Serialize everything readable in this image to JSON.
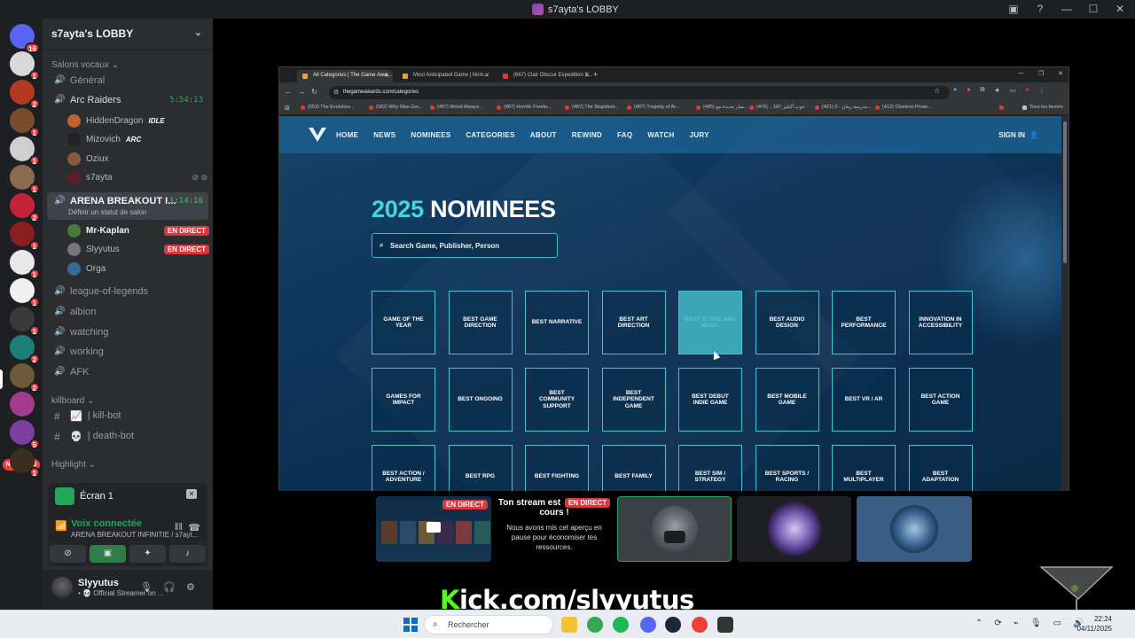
{
  "window": {
    "title": "s7ayta's LOBBY",
    "controls": [
      "mail-icon",
      "help-icon",
      "minimize-icon",
      "maximize-icon",
      "close-icon"
    ]
  },
  "rail": {
    "servers": [
      {
        "name": "discord-home",
        "badge": "16",
        "color": "#5865f2"
      },
      {
        "name": "server-1",
        "badge": "1",
        "color": "#d9d9d9"
      },
      {
        "name": "server-2",
        "badge": "2",
        "color": "#b23a1e"
      },
      {
        "name": "server-3",
        "badge": "1",
        "color": "#7a4b2a"
      },
      {
        "name": "server-4",
        "badge": "1",
        "color": "#cfcfcf"
      },
      {
        "name": "server-5",
        "badge": "1",
        "color": "#8a6b50"
      },
      {
        "name": "server-6",
        "badge": "2",
        "color": "#c4213a"
      },
      {
        "name": "server-7",
        "badge": "1",
        "color": "#8a1f1f"
      },
      {
        "name": "server-8",
        "badge": "1",
        "color": "#e8e8e8"
      },
      {
        "name": "server-9",
        "badge": "1",
        "color": "#f0f0f0"
      },
      {
        "name": "server-10",
        "badge": "1",
        "color": "#3a3a3a"
      },
      {
        "name": "server-11",
        "badge": "2",
        "color": "#1d7f7a"
      },
      {
        "name": "server-12",
        "badge": "2",
        "color": "#6d5a3a"
      },
      {
        "name": "server-13",
        "badge": "",
        "color": "#a33b8f"
      },
      {
        "name": "server-14",
        "badge": "5",
        "color": "#7b3fa0"
      },
      {
        "name": "server-15",
        "badge": "1",
        "color": "#3a2f1c"
      },
      {
        "name": "server-16",
        "badge": "",
        "color": "#c21f2a"
      }
    ],
    "new_label": "NOUVEAU"
  },
  "sidebar": {
    "server_name": "s7ayta's LOBBY",
    "voice_category": "Salons vocaux",
    "channels": {
      "general": "Général",
      "arc_raiders": "Arc Raiders",
      "arc_time": "5:54:13",
      "arena": "ARENA BREAKOUT I...",
      "arena_time": "1:14:16",
      "arena_status": "Définir un statut de salon",
      "lol": "league-of-legends",
      "albion": "albion",
      "watching": "watching",
      "working": "working",
      "afk": "AFK"
    },
    "arc_users": [
      {
        "name": "HiddenDragon",
        "tag": "IDLE",
        "color": "#c0622a"
      },
      {
        "name": "Mizovich",
        "tag": "ARC",
        "color": "#222"
      },
      {
        "name": "Oziux",
        "tag": "",
        "color": "#8a5a3a"
      },
      {
        "name": "s7ayta",
        "tag": "",
        "color": "#5b1f2a"
      }
    ],
    "arena_users": [
      {
        "name": "Mr-Kaplan",
        "live": "EN DIRECT",
        "color": "#4a7a3a"
      },
      {
        "name": "Slyyutus",
        "live": "EN DIRECT",
        "color": "#777"
      },
      {
        "name": "Orga",
        "live": "",
        "color": "#3a6a9a"
      }
    ],
    "killboard_category": "killboard",
    "killbot": "| kill-bot",
    "deathbot": "| death-bot",
    "highlight_category": "Highlight",
    "screen_label": "Écran 1",
    "voice_connected": "Voix connectée",
    "voice_channel": "ARENA BREAKOUT INFINITIE / s7ayt...",
    "user": {
      "name": "Slyyutus",
      "status": "• 💀 Official Streamer on ..."
    }
  },
  "browser": {
    "tabs": [
      {
        "label": "All Categories | The Game Awa...",
        "active": true,
        "color": "#e8a33a"
      },
      {
        "label": "Most Anticipated Game | Nom...",
        "active": false,
        "color": "#e8a33a"
      },
      {
        "label": "(667) Clair Obscur Expedition 3...",
        "active": false,
        "color": "#e53935"
      }
    ],
    "url": "thegameawards.com/categories",
    "bookmarks": [
      "(653) The Evolution...",
      "(582) Why Was Ger...",
      "(487) World Always...",
      "(487) Horrific Freefa...",
      "(487) The Stupidest...",
      "(487) Tragedy of Ar...",
      "(485) ميار جديدة مع...",
      "(476) ...187 خوب آکیلیز",
      "(421) مدرسة رمان - 0...",
      "(412) Clueless Prose..."
    ],
    "bookmarks_folder": "Tous les favoris"
  },
  "site": {
    "nav": [
      "HOME",
      "NEWS",
      "NOMINEES",
      "CATEGORIES",
      "ABOUT",
      "REWIND",
      "FAQ",
      "WATCH",
      "JURY"
    ],
    "signin": "SIGN IN",
    "heading_year": "2025",
    "heading_text": " NOMINEES",
    "search_placeholder": "Search Game, Publisher, Person",
    "categories": [
      "Game of the Year",
      "Best Game Direction",
      "Best Narrative",
      "Best Art Direction",
      "Best Score and Music",
      "Best Audio Design",
      "Best Performance",
      "Innovation in Accessibility",
      "Games for Impact",
      "Best Ongoing",
      "Best Community Support",
      "Best Independent Game",
      "Best Debut Indie Game",
      "Best Mobile Game",
      "Best VR / AR",
      "Best Action Game",
      "Best Action / Adventure",
      "Best RPG",
      "Best Fighting",
      "Best Family",
      "Best Sim / Strategy",
      "Best Sports / Racing",
      "Best Multiplayer",
      "Best Adaptation"
    ],
    "hovered_index": 4
  },
  "stream_strip": {
    "live_badge": "EN DIRECT",
    "pause_title_a": "Ton stream est",
    "pause_title_b": "cours !",
    "pause_text": "Nous avons mis cet aperçu en pause pour économiser tes ressources."
  },
  "overlay": {
    "kick_k": "K",
    "kick_rest": "ick.com/slyyutus"
  },
  "taskbar": {
    "search": "Rechercher",
    "time": "22:24",
    "date": "04/11/2025",
    "apps": [
      {
        "name": "file-explorer-icon",
        "color": "#f4c430"
      },
      {
        "name": "chrome-icon",
        "color": "#34a853"
      },
      {
        "name": "spotify-icon",
        "color": "#1db954"
      },
      {
        "name": "discord-icon",
        "color": "#5865f2"
      },
      {
        "name": "steam-icon",
        "color": "#1b2838"
      },
      {
        "name": "chrome-icon-2",
        "color": "#ea4335"
      },
      {
        "name": "game-icon",
        "color": "#333"
      }
    ]
  }
}
